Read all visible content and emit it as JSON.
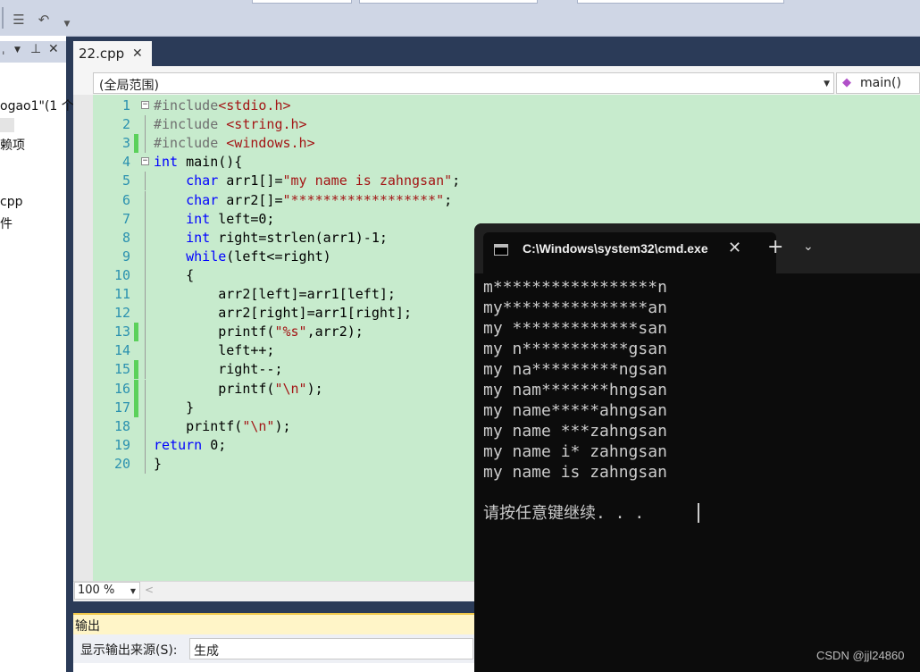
{
  "left_panel": {
    "header_icons": [
      "pin-icon",
      "close-icon"
    ],
    "items": [
      "ogao1\"(1 个",
      "赖项",
      "cpp",
      "件"
    ]
  },
  "editor": {
    "tab_label": "22.cpp",
    "scope_dropdown": "(全局范围)",
    "function_dropdown": "main()",
    "zoom": "100 %",
    "lines": [
      {
        "n": "1",
        "changed": false,
        "fold": "−",
        "tokens": [
          [
            "pp",
            "#include"
          ],
          [
            "str",
            "<stdio.h>"
          ]
        ]
      },
      {
        "n": "2",
        "changed": false,
        "fold": "",
        "tokens": [
          [
            "pp",
            "#include "
          ],
          [
            "str",
            "<string.h>"
          ]
        ]
      },
      {
        "n": "3",
        "changed": true,
        "fold": "",
        "tokens": [
          [
            "pp",
            "#include "
          ],
          [
            "str",
            "<windows.h>"
          ]
        ]
      },
      {
        "n": "4",
        "changed": false,
        "fold": "−",
        "tokens": [
          [
            "kw",
            "int"
          ],
          [
            "tx",
            " main(){"
          ]
        ]
      },
      {
        "n": "5",
        "changed": false,
        "fold": "",
        "tokens": [
          [
            "tx",
            "    "
          ],
          [
            "kw",
            "char"
          ],
          [
            "tx",
            " arr1[]="
          ],
          [
            "str",
            "\"my name is zahngsan\""
          ],
          [
            "tx",
            ";"
          ]
        ]
      },
      {
        "n": "6",
        "changed": false,
        "fold": "",
        "tokens": [
          [
            "tx",
            "    "
          ],
          [
            "kw",
            "char"
          ],
          [
            "tx",
            " arr2[]="
          ],
          [
            "str",
            "\"******************\""
          ],
          [
            "tx",
            ";"
          ]
        ]
      },
      {
        "n": "7",
        "changed": false,
        "fold": "",
        "tokens": [
          [
            "tx",
            "    "
          ],
          [
            "kw",
            "int"
          ],
          [
            "tx",
            " left=0;"
          ]
        ]
      },
      {
        "n": "8",
        "changed": false,
        "fold": "",
        "tokens": [
          [
            "tx",
            "    "
          ],
          [
            "kw",
            "int"
          ],
          [
            "tx",
            " right=strlen(arr1)-1;"
          ]
        ]
      },
      {
        "n": "9",
        "changed": false,
        "fold": "",
        "tokens": [
          [
            "tx",
            "    "
          ],
          [
            "kw",
            "while"
          ],
          [
            "tx",
            "(left<=right)"
          ]
        ]
      },
      {
        "n": "10",
        "changed": false,
        "fold": "",
        "tokens": [
          [
            "tx",
            "    {"
          ]
        ]
      },
      {
        "n": "11",
        "changed": false,
        "fold": "",
        "tokens": [
          [
            "tx",
            "        arr2[left]=arr1[left];"
          ]
        ]
      },
      {
        "n": "12",
        "changed": false,
        "fold": "",
        "tokens": [
          [
            "tx",
            "        arr2[right]=arr1[right];"
          ]
        ]
      },
      {
        "n": "13",
        "changed": true,
        "fold": "",
        "tokens": [
          [
            "tx",
            "        printf("
          ],
          [
            "str",
            "\"%s\""
          ],
          [
            "tx",
            ",arr2);"
          ]
        ]
      },
      {
        "n": "14",
        "changed": false,
        "fold": "",
        "tokens": [
          [
            "tx",
            "        left++;"
          ]
        ]
      },
      {
        "n": "15",
        "changed": true,
        "fold": "",
        "tokens": [
          [
            "tx",
            "        right--;"
          ]
        ]
      },
      {
        "n": "16",
        "changed": true,
        "fold": "",
        "tokens": [
          [
            "tx",
            "        printf("
          ],
          [
            "str",
            "\"\\n\""
          ],
          [
            "tx",
            ");"
          ]
        ]
      },
      {
        "n": "17",
        "changed": true,
        "fold": "",
        "tokens": [
          [
            "tx",
            "    }"
          ]
        ]
      },
      {
        "n": "18",
        "changed": false,
        "fold": "",
        "tokens": [
          [
            "tx",
            "    printf("
          ],
          [
            "str",
            "\"\\n\""
          ],
          [
            "tx",
            ");"
          ]
        ]
      },
      {
        "n": "19",
        "changed": false,
        "fold": "",
        "tokens": [
          [
            "kw",
            "return"
          ],
          [
            "tx",
            " 0;"
          ]
        ]
      },
      {
        "n": "20",
        "changed": false,
        "fold": "",
        "tokens": [
          [
            "tx",
            "}"
          ]
        ]
      }
    ]
  },
  "output_panel": {
    "title": "输出",
    "source_label": "显示输出来源(S):",
    "source_value": "生成"
  },
  "cmd": {
    "tab_title": "C:\\Windows\\system32\\cmd.exe",
    "new_tab": "+",
    "output": [
      "m*****************n",
      "my***************an",
      "my *************san",
      "my n***********gsan",
      "my na*********ngsan",
      "my nam*******hngsan",
      "my name*****ahngsan",
      "my name ***zahngsan",
      "my name i* zahngsan",
      "my name is zahngsan",
      "",
      "请按任意键继续. . ."
    ]
  },
  "watermark": "CSDN @jjl24860",
  "colors": {
    "editor_bg": "#c7ebcd",
    "keyword": "#0000ff",
    "string": "#a31515",
    "preprocessor": "#6f6f6f",
    "line_number": "#2b91af",
    "changed_marker": "#5bd15b",
    "console_bg": "#0c0c0c"
  }
}
